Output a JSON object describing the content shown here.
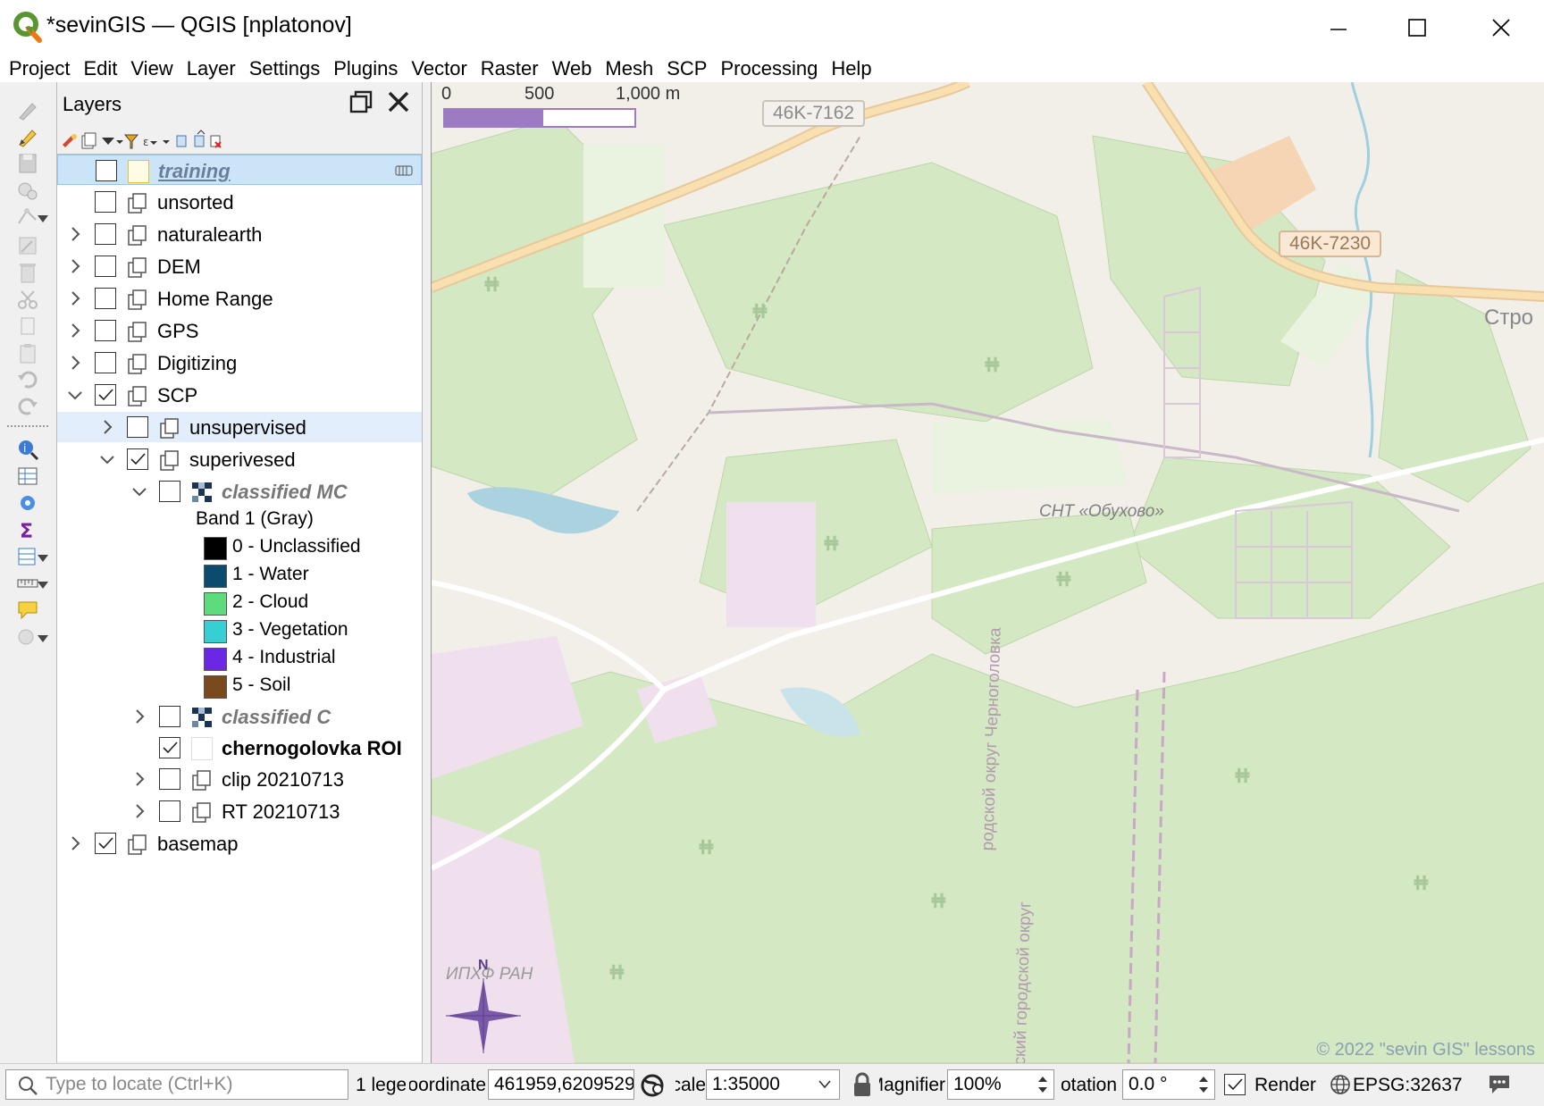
{
  "window": {
    "title": "*sevinGIS — QGIS [nplatonov]",
    "minimize_icon": "minimize-icon",
    "maximize_icon": "maximize-icon",
    "close_icon": "close-icon"
  },
  "menu": [
    "Project",
    "Edit",
    "View",
    "Layer",
    "Settings",
    "Plugins",
    "Vector",
    "Raster",
    "Web",
    "Mesh",
    "SCP",
    "Processing",
    "Help"
  ],
  "layers_panel": {
    "title": "Layers",
    "layers": {
      "training": "training",
      "unsorted": "unsorted",
      "naturalearth": "naturalearth",
      "dem": "DEM",
      "home_range": "Home Range",
      "gps": "GPS",
      "digitizing": "Digitizing",
      "scp": "SCP",
      "unsupervised": "unsupervised",
      "superivesed": "superivesed",
      "classified_mc": "classified MC",
      "band_label": "Band 1 (Gray)",
      "classified_c": "classified C",
      "roi": "chernogolovka ROI",
      "clip": "clip 20210713",
      "rt": "RT 20210713",
      "basemap": "basemap"
    },
    "legend": [
      {
        "label": "0 - Unclassified",
        "color": "#000000"
      },
      {
        "label": "1 - Water",
        "color": "#0b4b6e"
      },
      {
        "label": "2 - Cloud",
        "color": "#5ddc7e"
      },
      {
        "label": "3 - Vegetation",
        "color": "#36cfd4"
      },
      {
        "label": "4 - Industrial",
        "color": "#6b27e6"
      },
      {
        "label": "5 - Soil",
        "color": "#7a4a1c"
      }
    ]
  },
  "map": {
    "scalebar": {
      "label_0": "0",
      "label_500": "500",
      "label_1000": "1,000 m"
    },
    "road_labels": {
      "r1": "46K-7162",
      "r2": "46K-7230"
    },
    "place_labels": {
      "town": "Стро",
      "snt": "СНТ «Обухово»",
      "ipkhf": "ИПХФ РАН",
      "district1": "родской округ Черноголовка",
      "district2": "ский городской округ"
    },
    "north_label": "N",
    "copyright": "© 2022 \"sevin GIS\" lessons"
  },
  "status": {
    "locator_placeholder": "Type to locate (Ctrl+K)",
    "legend_msg": "1 lege",
    "coord_label": "Coordinate",
    "coordinate": "461959,6209529",
    "scale_label": "Scale",
    "scale": "1:35000",
    "magnifier_label": "Magnifier",
    "magnifier": "100%",
    "rotation_label": "Rotation",
    "rotation": "0.0 °",
    "render_label": "Render",
    "crs": "EPSG:32637"
  },
  "colors": {
    "accent": "#589632",
    "selection": "#cce4f7",
    "map_forest": "#d4e8c4",
    "map_land": "#f2efe9"
  }
}
